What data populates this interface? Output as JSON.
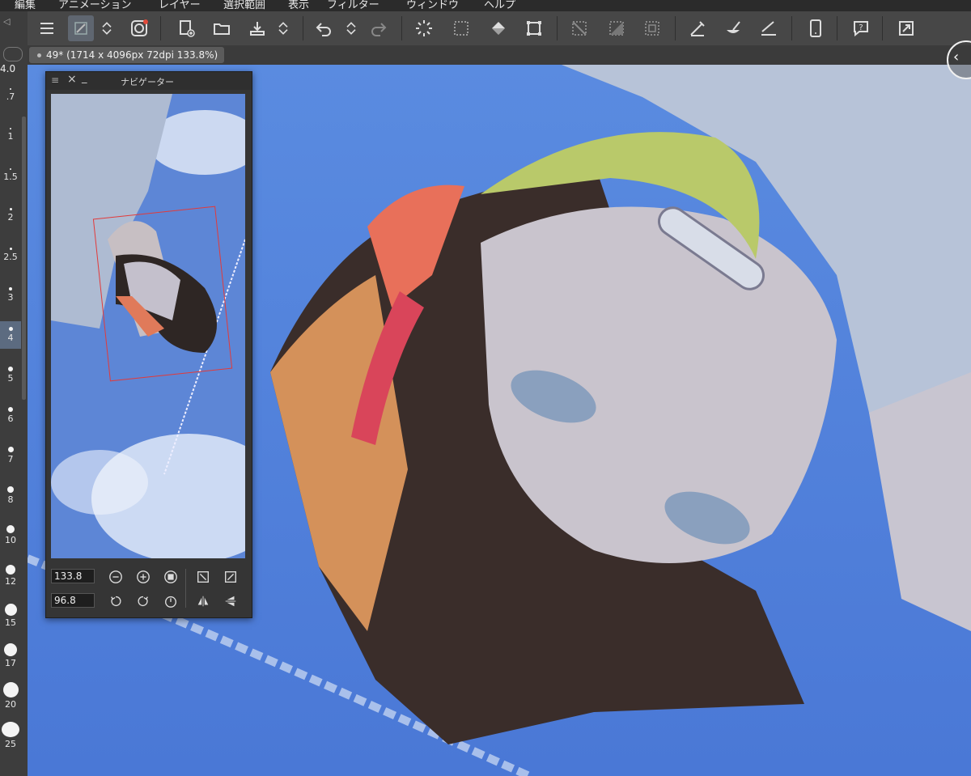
{
  "menubar": {
    "items": [
      "編集",
      "アニメーション",
      "レイヤー",
      "選択範囲",
      "表示",
      "フィルター",
      "ウィンドウ",
      "ヘルプ"
    ]
  },
  "toolbar": {
    "icons": [
      "menu-icon",
      "command-bar-eraser-icon",
      "up-down-arrows-icon",
      "clip-studio-icon",
      "new-canvas-icon",
      "open-folder-icon",
      "save-icon",
      "up-down-arrows-icon",
      "undo-icon",
      "up-down-arrows-icon",
      "redo-icon",
      "loading-spinner-icon",
      "select-all-icon",
      "fill-bucket-icon",
      "transform-icon",
      "clear-selection-icon",
      "invert-selection-icon",
      "selection-border-icon",
      "pen-icon",
      "brush-icon",
      "ruler-pen-icon",
      "smartphone-icon",
      "help-icon",
      "fullscreen-icon"
    ]
  },
  "left_strip": {
    "brush_size_top": "4.0",
    "brush_sizes": [
      ".7",
      "1",
      "1.5",
      "2",
      "2.5",
      "3",
      "4",
      "5",
      "6",
      "7",
      "8",
      "10",
      "12",
      "15",
      "17",
      "20",
      "25"
    ],
    "selected_index": 6
  },
  "document": {
    "tab_label": "49* (1714 x 4096px 72dpi 133.8%)"
  },
  "navigator": {
    "title": "ナビゲーター",
    "zoom_value": "133.8",
    "rotation_value": "96.8"
  },
  "colors": {
    "accent": "#5c6b80",
    "sky": "#4f7fd8",
    "nav_frame": "#e23a3a"
  }
}
